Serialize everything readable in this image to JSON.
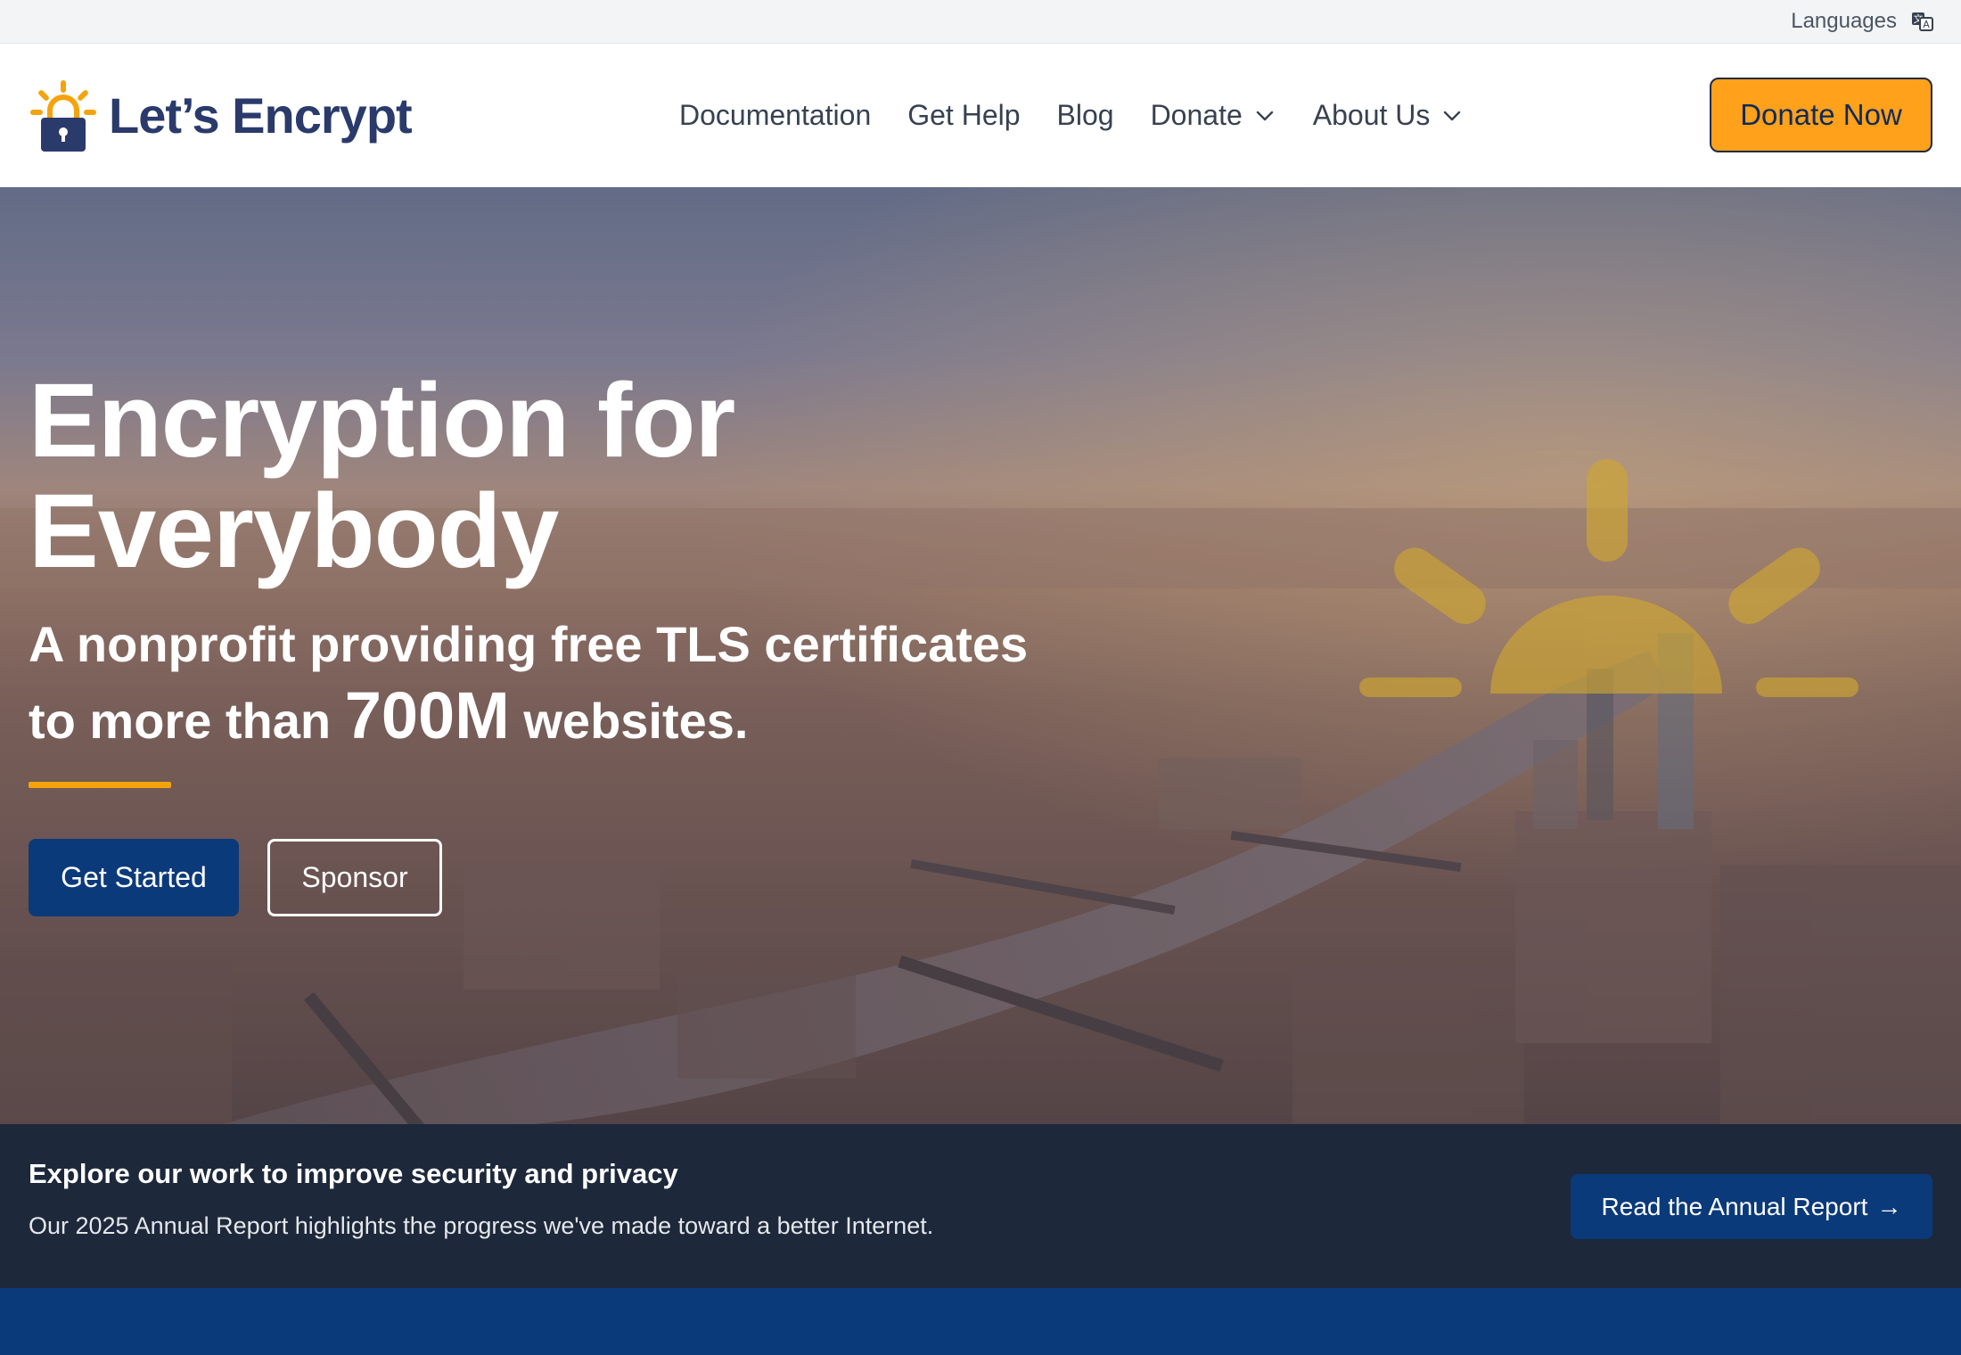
{
  "topbar": {
    "languages_label": "Languages",
    "icon": "translate-icon"
  },
  "header": {
    "logo_text": "Let’s Encrypt",
    "nav": [
      {
        "label": "Documentation",
        "dropdown": false
      },
      {
        "label": "Get Help",
        "dropdown": false
      },
      {
        "label": "Blog",
        "dropdown": false
      },
      {
        "label": "Donate",
        "dropdown": true
      },
      {
        "label": "About Us",
        "dropdown": true
      }
    ],
    "donate_now_label": "Donate Now"
  },
  "hero": {
    "title_line1": "Encryption for",
    "title_line2": "Everybody",
    "subtitle_part1": "A nonprofit providing free TLS certificates",
    "subtitle_part2": "to more than",
    "subtitle_number": "700M",
    "subtitle_part3": "websites.",
    "primary_button": "Get Started",
    "secondary_button": "Sponsor"
  },
  "report": {
    "heading": "Explore our work to improve security and privacy",
    "description": "Our 2025 Annual Report highlights the progress we've made toward a better Internet.",
    "button_label": "Read the Annual Report",
    "button_arrow": "→"
  },
  "colors": {
    "brand_navy": "#2a3a6b",
    "accent_orange": "#ffa11a",
    "primary_blue": "#0b3a7a",
    "banner_dark": "#1d283b"
  }
}
